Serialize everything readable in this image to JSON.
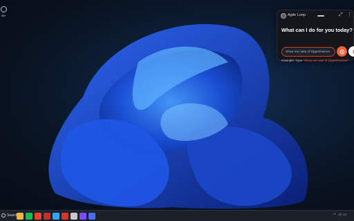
{
  "desktop": {
    "icon": "recycle-bin-icon",
    "icon_label": "Bin"
  },
  "widget": {
    "brand": "Agile Loop",
    "title": "What can I do for you today?",
    "input_value": "Show me case of Oppenheimer",
    "example_prefix": "Example: Type ",
    "example_quote": "\"show me cast of Oppenheimer\"",
    "accent": "#f0603a",
    "icons": [
      "agile-loop-logo-icon",
      "drag-handle-icon",
      "expand-icon",
      "more-icon",
      "send-icon",
      "mic-icon"
    ]
  },
  "taskbar": {
    "search_label": "Search",
    "apps": [
      {
        "name": "files-app-icon",
        "color": "#e8b84a"
      },
      {
        "name": "spotify-icon",
        "color": "#1db954"
      },
      {
        "name": "chrome-icon",
        "color": "#e94235"
      },
      {
        "name": "app-red-icon",
        "color": "#c4302b"
      },
      {
        "name": "photoshop-icon",
        "color": "#31a8ff"
      },
      {
        "name": "acrobat-icon",
        "color": "#d4352d"
      },
      {
        "name": "store-icon",
        "color": "#c9c9c9"
      },
      {
        "name": "app-purple-icon",
        "color": "#7c4dff"
      },
      {
        "name": "app-blue-icon",
        "color": "#4a6cf7"
      }
    ],
    "tray": [
      "wifi-icon",
      "volume-icon",
      "battery-icon"
    ]
  }
}
